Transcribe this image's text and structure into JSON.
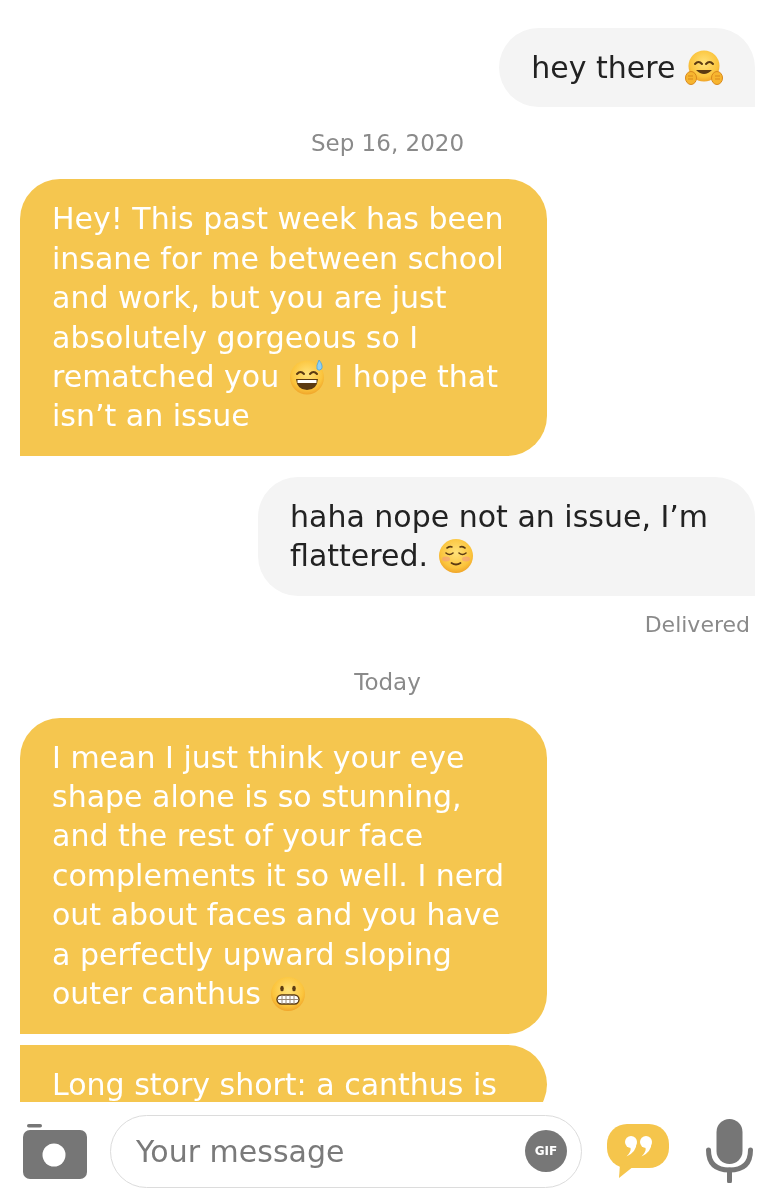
{
  "conversation": {
    "items": [
      {
        "kind": "sent",
        "segments": [
          {
            "kind": "text",
            "text": "hey there "
          },
          {
            "kind": "hugging"
          }
        ]
      },
      {
        "kind": "date",
        "text": "Sep 16, 2020"
      },
      {
        "kind": "received",
        "segments": [
          {
            "kind": "text",
            "text": "Hey! This past week has been insane for me between school and work, but you are just absolutely gorgeous so I rematched you "
          },
          {
            "kind": "sweat"
          },
          {
            "kind": "text",
            "text": " I hope that isn’t an issue"
          }
        ]
      },
      {
        "kind": "sent",
        "segments": [
          {
            "kind": "text",
            "text": "haha nope not an issue, I’m flattered. "
          },
          {
            "kind": "blush"
          }
        ]
      },
      {
        "kind": "status",
        "text": "Delivered"
      },
      {
        "kind": "date",
        "text": "Today"
      },
      {
        "kind": "received",
        "segments": [
          {
            "kind": "text",
            "text": "I mean I just think your eye shape alone is so stunning, and the rest of your face complements it so well. I nerd out about faces and you have a perfectly upward sloping outer canthus "
          },
          {
            "kind": "grimace"
          }
        ]
      },
      {
        "kind": "received",
        "segments": [
          {
            "kind": "text",
            "text": "Long story short: a canthus is"
          }
        ]
      }
    ]
  },
  "composer": {
    "placeholder": "Your message",
    "gif_label": "GIF"
  }
}
